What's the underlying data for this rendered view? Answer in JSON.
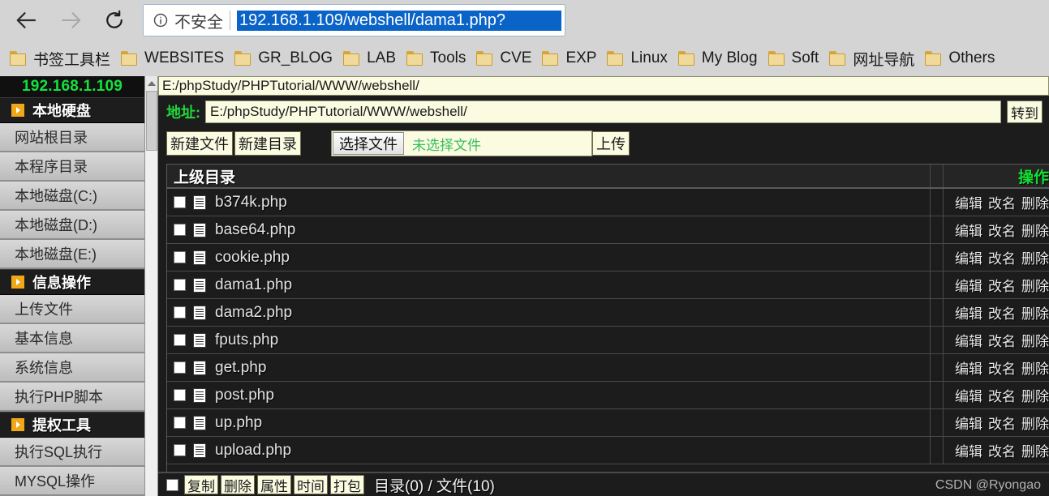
{
  "browser": {
    "back_icon": "back-arrow-icon",
    "forward_icon": "forward-arrow-icon",
    "reload_icon": "reload-icon",
    "security_icon": "info-circle-icon",
    "security_text": "不安全",
    "url": "192.168.1.109/webshell/dama1.php?",
    "bookmarks": [
      {
        "label": "书签工具栏"
      },
      {
        "label": "WEBSITES"
      },
      {
        "label": "GR_BLOG"
      },
      {
        "label": "LAB"
      },
      {
        "label": "Tools"
      },
      {
        "label": "CVE"
      },
      {
        "label": "EXP"
      },
      {
        "label": "Linux"
      },
      {
        "label": "My Blog"
      },
      {
        "label": "Soft"
      },
      {
        "label": "网址导航"
      },
      {
        "label": "Others"
      }
    ]
  },
  "sidebar": {
    "ip": "192.168.1.109",
    "groups": [
      {
        "title": "本地硬盘",
        "items": [
          {
            "label": "网站根目录"
          },
          {
            "label": "本程序目录"
          },
          {
            "label": "本地磁盘(C:)"
          },
          {
            "label": "本地磁盘(D:)"
          },
          {
            "label": "本地磁盘(E:)"
          }
        ]
      },
      {
        "title": "信息操作",
        "items": [
          {
            "label": "上传文件"
          },
          {
            "label": "基本信息"
          },
          {
            "label": "系统信息"
          },
          {
            "label": "执行PHP脚本"
          }
        ]
      },
      {
        "title": "提权工具",
        "items": [
          {
            "label": "执行SQL执行"
          },
          {
            "label": "MYSQL操作"
          }
        ]
      }
    ]
  },
  "main": {
    "path_bar": "E:/phpStudy/PHPTutorial/WWW/webshell/",
    "address_label": "地址:",
    "address_value": "E:/phpStudy/PHPTutorial/WWW/webshell/",
    "go_button": "转到",
    "new_file_button": "新建文件",
    "new_dir_button": "新建目录",
    "choose_file_button": "选择文件",
    "no_file_text": "未选择文件",
    "upload_button": "上传",
    "table": {
      "parent_dir_label": "上级目录",
      "ops_header": "操作",
      "op_links": [
        "编辑",
        "改名",
        "删除"
      ],
      "rows": [
        {
          "name": "b374k.php"
        },
        {
          "name": "base64.php"
        },
        {
          "name": "cookie.php"
        },
        {
          "name": "dama1.php"
        },
        {
          "name": "dama2.php"
        },
        {
          "name": "fputs.php"
        },
        {
          "name": "get.php"
        },
        {
          "name": "post.php"
        },
        {
          "name": "up.php"
        },
        {
          "name": "upload.php"
        }
      ]
    },
    "bottom": {
      "buttons": [
        "复制",
        "删除",
        "属性",
        "时间",
        "打包"
      ],
      "count_text": "目录(0) / 文件(10)"
    }
  },
  "watermark": "CSDN @Ryongao",
  "colors": {
    "accent_green": "#15e03c",
    "url_highlight": "#0a64c8",
    "cream": "#fbfbe2",
    "panel_black": "#1c1c1c"
  }
}
